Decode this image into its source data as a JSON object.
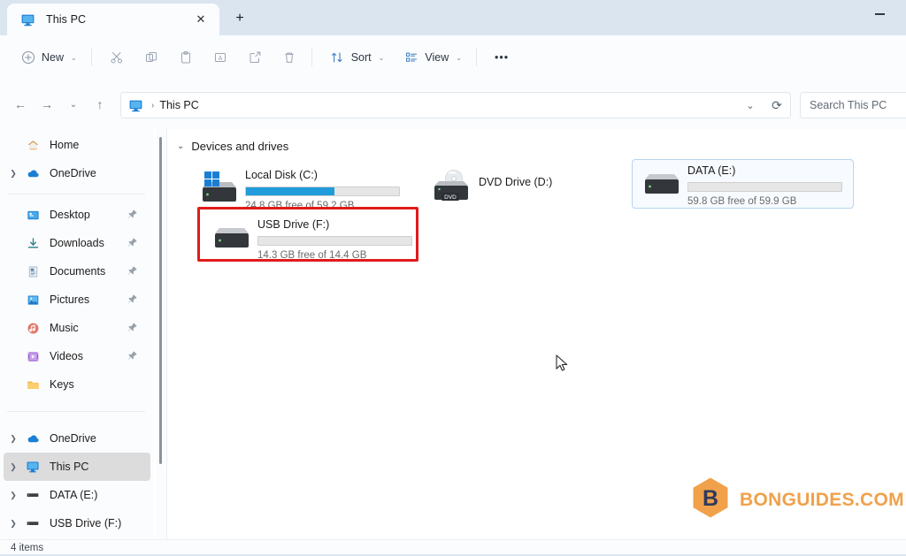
{
  "window": {
    "tab_title": "This PC",
    "tab_close_label": "✕",
    "new_tab_label": "+",
    "minimize_label": "minimize"
  },
  "toolbar": {
    "new_label": "New",
    "new_icon": "plus-circle-icon",
    "cut_icon": "scissors-icon",
    "copy_icon": "copy-icon",
    "paste_icon": "clipboard-icon",
    "rename_icon": "rename-icon",
    "share_icon": "share-icon",
    "delete_icon": "trash-icon",
    "sort_label": "Sort",
    "sort_icon": "sort-arrows-icon",
    "view_label": "View",
    "view_icon": "view-list-icon",
    "more_label": "•••",
    "chevron": "⌄"
  },
  "navigation": {
    "back_label": "←",
    "forward_label": "→",
    "recent_label": "⌄",
    "up_label": "↑",
    "address_icon": "this-pc-icon",
    "address_separator": "›",
    "address_text": "This PC",
    "address_dropdown": "⌄",
    "refresh_label": "⟳"
  },
  "search": {
    "placeholder": "Search This PC"
  },
  "sidebar": {
    "groups": [
      {
        "items": [
          {
            "label": "Home",
            "icon": "home-icon",
            "expandable": false,
            "pinned": false,
            "selected": false
          },
          {
            "label": "OneDrive",
            "icon": "cloud-icon",
            "expandable": true,
            "pinned": false,
            "selected": false
          }
        ]
      },
      {
        "items": [
          {
            "label": "Desktop",
            "icon": "desktop-icon",
            "expandable": false,
            "pinned": true,
            "selected": false
          },
          {
            "label": "Downloads",
            "icon": "download-icon",
            "expandable": false,
            "pinned": true,
            "selected": false
          },
          {
            "label": "Documents",
            "icon": "documents-icon",
            "expandable": false,
            "pinned": true,
            "selected": false
          },
          {
            "label": "Pictures",
            "icon": "pictures-icon",
            "expandable": false,
            "pinned": true,
            "selected": false
          },
          {
            "label": "Music",
            "icon": "music-icon",
            "expandable": false,
            "pinned": true,
            "selected": false
          },
          {
            "label": "Videos",
            "icon": "videos-icon",
            "expandable": false,
            "pinned": true,
            "selected": false
          },
          {
            "label": "Keys",
            "icon": "folder-icon",
            "expandable": false,
            "pinned": false,
            "selected": false
          }
        ]
      },
      {
        "items": [
          {
            "label": "OneDrive",
            "icon": "cloud-icon",
            "expandable": true,
            "pinned": false,
            "selected": false
          },
          {
            "label": "This PC",
            "icon": "this-pc-icon",
            "expandable": true,
            "pinned": false,
            "selected": true
          },
          {
            "label": "DATA (E:)",
            "icon": "drive-icon",
            "expandable": true,
            "pinned": false,
            "selected": false
          },
          {
            "label": "USB Drive (F:)",
            "icon": "drive-icon",
            "expandable": true,
            "pinned": false,
            "selected": false
          }
        ]
      }
    ]
  },
  "main": {
    "group_title": "Devices and drives",
    "group_chevron": "⌄",
    "drives": [
      {
        "name": "Local Disk (C:)",
        "free_text": "24.8 GB free of 59.2 GB",
        "used_percent": 58,
        "bar_color": "#1f9cd9",
        "has_bar": true,
        "icon": "windows-drive-icon",
        "highlighted": false,
        "hovered": false
      },
      {
        "name": "DVD Drive (D:)",
        "free_text": "",
        "used_percent": 0,
        "bar_color": "",
        "has_bar": false,
        "icon": "dvd-drive-icon",
        "highlighted": false,
        "hovered": false
      },
      {
        "name": "DATA (E:)",
        "free_text": "59.8 GB free of 59.9 GB",
        "used_percent": 0,
        "bar_color": "#1f9cd9",
        "has_bar": true,
        "icon": "hard-drive-icon",
        "highlighted": false,
        "hovered": true
      },
      {
        "name": "USB Drive (F:)",
        "free_text": "14.3 GB free of 14.4 GB",
        "used_percent": 0,
        "bar_color": "#1f9cd9",
        "has_bar": true,
        "icon": "hard-drive-icon",
        "highlighted": true,
        "hovered": false
      }
    ],
    "highlight_color": "#e01b1b"
  },
  "watermark": {
    "text": "BONGUIDES.COM",
    "mark_letter": "B",
    "hex_color": "#f0a14a",
    "letter_color": "#2e3a5c"
  },
  "statusbar": {
    "item_count": "4 items"
  }
}
